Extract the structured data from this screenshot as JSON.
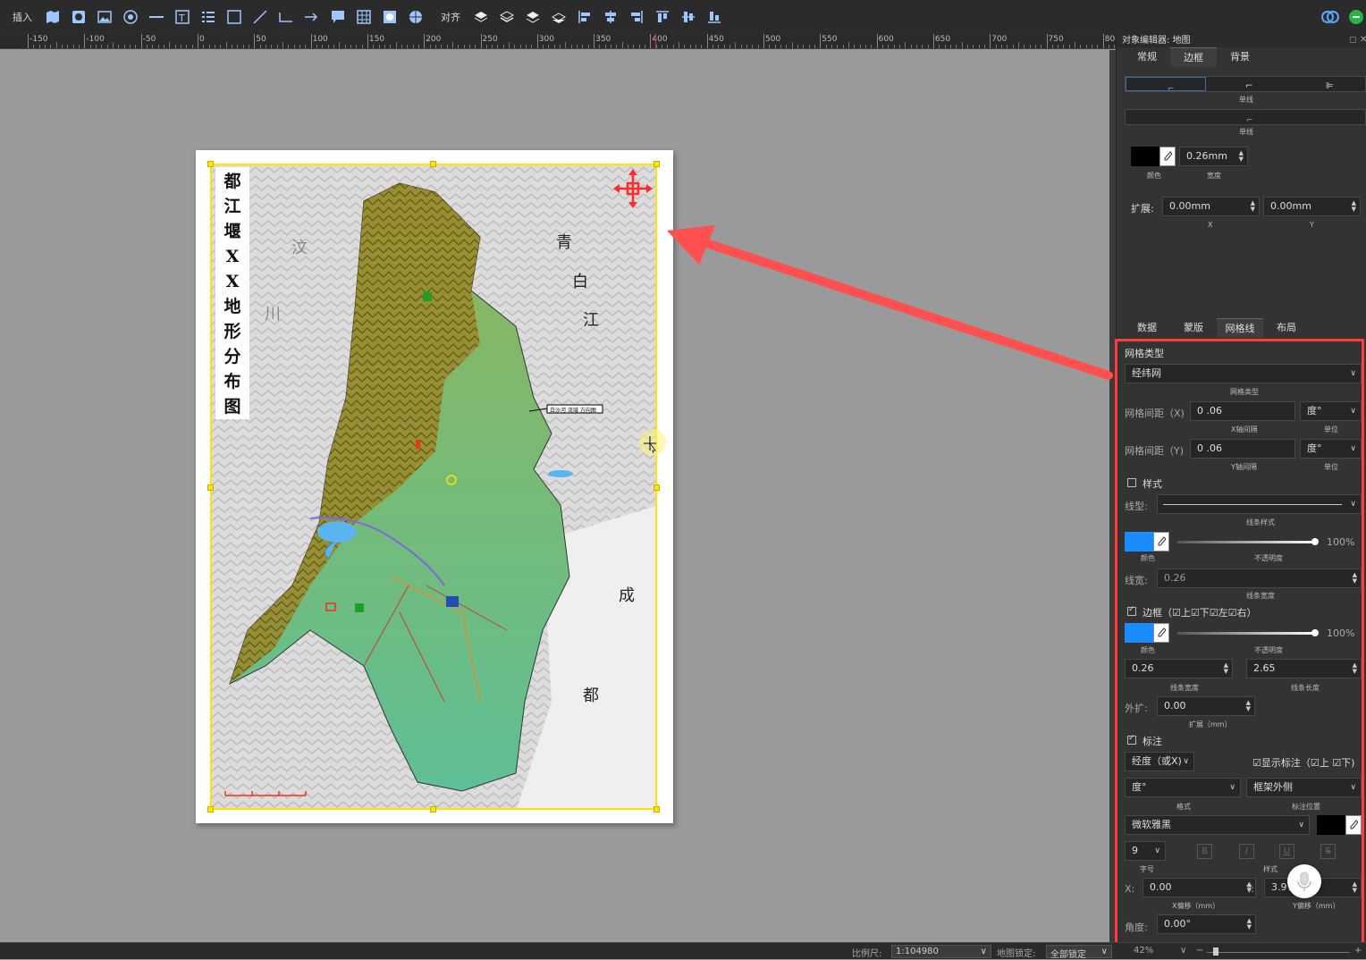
{
  "toolbar": {
    "insert_label": "插入",
    "align_label": "对齐"
  },
  "ruler": {
    "labels": [
      "-150",
      "-100",
      "-50",
      "0",
      "50",
      "100",
      "150",
      "200",
      "250",
      "300",
      "350",
      "400",
      "450",
      "500",
      "550",
      "600",
      "650",
      "700",
      "750",
      "800"
    ]
  },
  "map": {
    "title_chars": [
      "都",
      "江",
      "堰",
      "X",
      "X",
      "地",
      "形",
      "分",
      "布",
      "图"
    ],
    "places": {
      "wen": "汶",
      "chuan": "川",
      "qing": "青",
      "bai": "白",
      "jiang": "江",
      "cheng": "成",
      "du": "都"
    },
    "callout": "白沙河 流域 方向图"
  },
  "panel": {
    "title": "对象编辑器: 地图",
    "tabs": [
      "常规",
      "边框",
      "背景"
    ],
    "border": {
      "line_caption_1": "单线",
      "line_caption_2": "单线",
      "width_value": "0.26mm",
      "color_caption": "颜色",
      "width_caption": "宽度",
      "expand_label": "扩展:",
      "expand_x": "0.00mm",
      "expand_y": "0.00mm",
      "x_caption": "X",
      "y_caption": "Y"
    },
    "tabs2": [
      "数据",
      "蒙版",
      "网格线",
      "布局"
    ],
    "grid": {
      "type_label": "网格类型",
      "type_value": "经纬网",
      "type_caption": "网格类型",
      "spacing_x_label": "网格间距（X)",
      "spacing_x_value": "0 .06",
      "spacing_x_caption": "X轴间隔",
      "spacing_y_label": "网格间距（Y)",
      "spacing_y_value": "0 .06",
      "spacing_y_caption": "Y轴间隔",
      "unit_value": "度°",
      "unit_caption": "单位",
      "style_label": "样式",
      "linetype_label": "线型:",
      "linestyle_caption": "线条样式",
      "color_caption": "颜色",
      "opacity_caption": "不透明度",
      "opacity_value": "100%",
      "linewidth_label": "线宽:",
      "linewidth_value": "0.26",
      "linewidth_caption": "线条宽度",
      "border_label": "边框（",
      "border_top": "上",
      "border_bottom": "下",
      "border_left": "左",
      "border_right": "右）",
      "border_opacity": "100%",
      "border_width": "0.26",
      "border_length": "2.65",
      "border_width_caption": "线条宽度",
      "border_length_caption": "线条长度",
      "outer_label": "外扩:",
      "outer_value": "0.00",
      "outer_caption": "扩展（mm）",
      "label_label": "标注",
      "label_axis": "经度（或X)",
      "show_label": "显示标注（",
      "show_top": "上",
      "show_bottom": "下)",
      "format_value": "度°",
      "format_caption": "格式",
      "position_value": "框架外侧",
      "position_caption": "标注位置",
      "font_value": "微软雅黑",
      "size_value": "9",
      "size_caption": "字号",
      "style_caption": "样式",
      "x_label": "X:",
      "x_value": "0.00",
      "x_caption": "X偏移（mm）",
      "y_label": "Y:",
      "y_value": "3.97",
      "y_caption": "Y偏移（mm）",
      "angle_label": "角度:",
      "angle_value": "0.00°"
    }
  },
  "statusbar": {
    "scale_label": "比例尺:",
    "scale_value": "1:104980",
    "lock_label": "地图锁定:",
    "lock_value": "全部锁定",
    "zoom_value": "42%"
  },
  "colors": {
    "accent_blue": "#1a8cff",
    "highlight_red": "#ff3b3b",
    "frame_yellow": "#ffe500"
  }
}
